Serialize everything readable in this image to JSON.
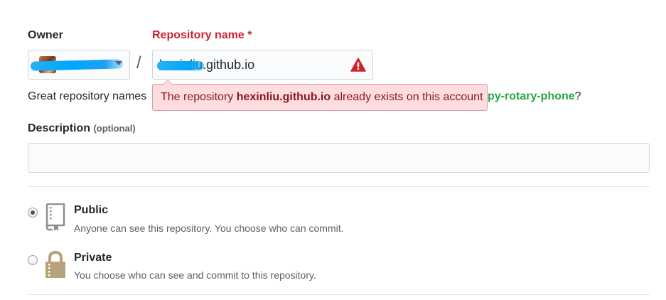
{
  "owner": {
    "label": "Owner"
  },
  "repository": {
    "label": "Repository name *",
    "value": "hexinliu.github.io",
    "visible_suffix": ".github.io"
  },
  "hint": {
    "prefix": "Great repository names",
    "suggestion": "py-rotary-phone",
    "suffix": "?"
  },
  "error": {
    "before": "The repository ",
    "name": "hexinliu.github.io",
    "after": " already exists on this account"
  },
  "description": {
    "label": "Description",
    "optional": "(optional)",
    "value": ""
  },
  "visibility": {
    "selected": "public",
    "options": [
      {
        "key": "public",
        "title": "Public",
        "description": "Anyone can see this repository. You choose who can commit."
      },
      {
        "key": "private",
        "title": "Private",
        "description": "You choose who can see and commit to this repository."
      }
    ]
  },
  "colors": {
    "error_text": "#cb2431",
    "error_bg": "#ffdce0",
    "suggestion": "#28a745",
    "lock": "#b8a279",
    "book": "#8a9096"
  },
  "icons": {
    "warning": "alert-triangle-icon",
    "public": "repo-book-icon",
    "private": "lock-icon",
    "owner_dropdown": "chevron-down-icon"
  }
}
